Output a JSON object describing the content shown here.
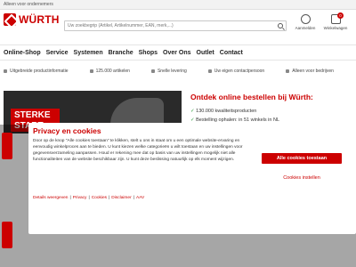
{
  "topbar": {
    "text": "Alleen voor ondernemers"
  },
  "brand": {
    "name": "WÜRTH",
    "color": "#cc0000"
  },
  "search": {
    "placeholder": "Uw zoekbegrip (Artikel, Artikelnummer, EAN, merk,...)"
  },
  "header_actions": {
    "account_label": "Aanmelden",
    "cart_label": "Winkelwagen",
    "cart_count": "0"
  },
  "nav": [
    "Online-Shop",
    "Service",
    "Systemen",
    "Branche",
    "Shops",
    "Over Ons",
    "Outlet",
    "Contact"
  ],
  "usps": [
    "Uitgebreide productinformatie",
    "125.000 artikelen",
    "Snelle levering",
    "Uw eigen contactpersoon",
    "Alleen voor bedrijven"
  ],
  "banner": {
    "sign_line1": "STERKE",
    "sign_line2": "START"
  },
  "promo": {
    "title": "Ontdek online bestellen bij Würth:",
    "items": [
      "130.000 kwaliteitsproducten",
      "Bestelling ophalen: in 51 winkels in NL"
    ]
  },
  "cookie": {
    "title": "Privacy en cookies",
    "body": "Door op de knop \"Alle cookies toestaan\" te klikken, stelt u ons in staat om u een optimale website-ervaring en eenvoudig winkelproces aan te bieden. U kunt kiezen welke categorieën u wilt toestaan en uw instellingen voor gegevensverzameling aanpassen. Houd er rekening mee dat op basis van uw instellingen mogelijk niet alle functionaliteiten van de website beschikbaar zijn. U kunt deze beslissing natuurlijk op elk moment wijzigen.",
    "links": [
      "Details weergeven",
      "Privacy",
      "Cookies",
      "Disclaimer",
      "AAV"
    ],
    "accept_label": "Alle cookies toestaan",
    "settings_label": "Cookies instellen"
  }
}
